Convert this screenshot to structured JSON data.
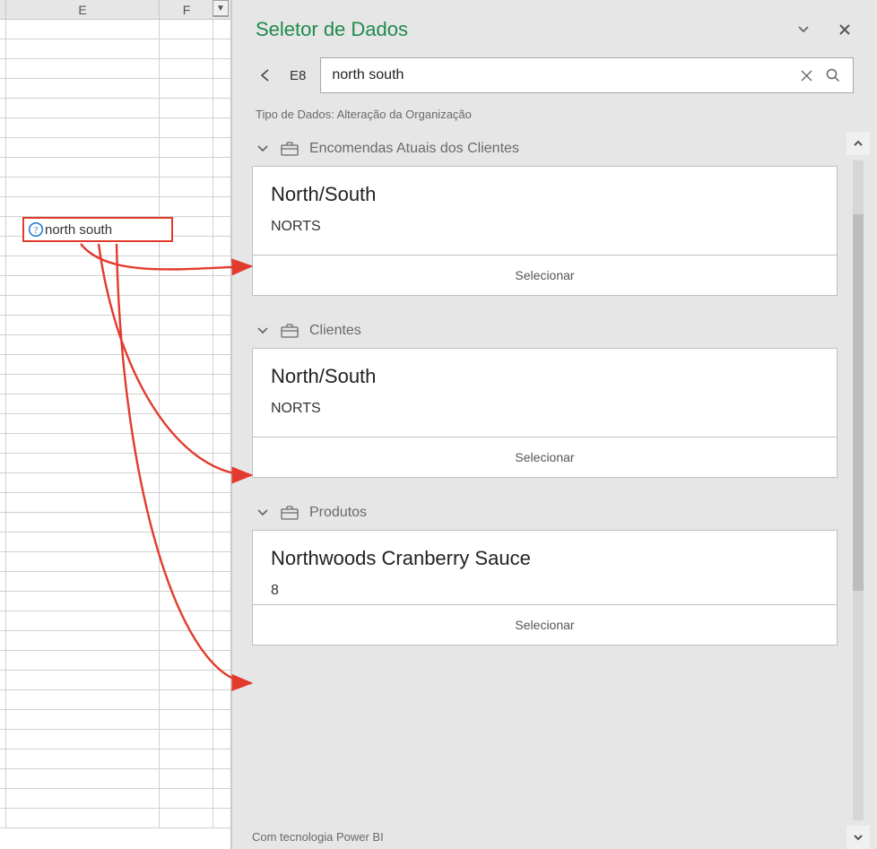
{
  "grid": {
    "columns": {
      "E": "E",
      "F": "F"
    },
    "highlighted_cell": {
      "ref": "E8",
      "icon": "question-icon",
      "text": "north south"
    }
  },
  "pane": {
    "title": "Seletor de Dados",
    "cell_ref": "E8",
    "search": {
      "value": "north south",
      "placeholder": ""
    },
    "type_line": "Tipo de Dados: Alteração da Organização",
    "sections": [
      {
        "id": "sec-encomendas",
        "label": "Encomendas Atuais dos Clientes",
        "card": {
          "title": "North/South",
          "sub": "NORTS",
          "select": "Selecionar"
        }
      },
      {
        "id": "sec-clientes",
        "label": "Clientes",
        "card": {
          "title": "North/South",
          "sub": "NORTS",
          "select": "Selecionar"
        }
      },
      {
        "id": "sec-produtos",
        "label": "Produtos",
        "card": {
          "title": "Northwoods Cranberry Sauce",
          "sub": "8",
          "select": "Selecionar"
        }
      }
    ],
    "footer": "Com tecnologia Power BI"
  }
}
